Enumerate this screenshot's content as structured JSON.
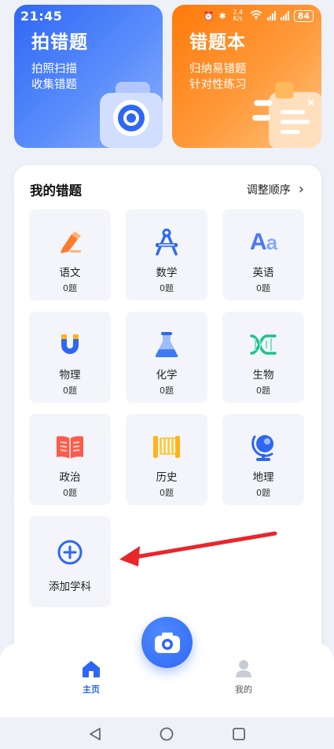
{
  "status_bar": {
    "time": "21:45",
    "net_speed": "2.4 K/s",
    "battery": "84"
  },
  "cards": {
    "capture": {
      "title": "拍错题",
      "subtitle_line1": "拍照扫描",
      "subtitle_line2": "收集错题"
    },
    "notebook": {
      "title": "错题本",
      "subtitle_line1": "归纳易错题",
      "subtitle_line2": "针对性练习"
    }
  },
  "panel": {
    "title": "我的错题",
    "reorder_label": "调整顺序"
  },
  "subjects": [
    {
      "name": "语文",
      "count": "0题",
      "icon": "pen-icon",
      "color": "#ff7a2e"
    },
    {
      "name": "数学",
      "count": "0题",
      "icon": "compass-icon",
      "color": "#2f67f4"
    },
    {
      "name": "英语",
      "count": "0题",
      "icon": "aa-letters-icon",
      "color": "#4a78f5"
    },
    {
      "name": "物理",
      "count": "0题",
      "icon": "magnet-icon",
      "color": "#2f67f4"
    },
    {
      "name": "化学",
      "count": "0题",
      "icon": "flask-icon",
      "color": "#3b7cf6"
    },
    {
      "name": "生物",
      "count": "0题",
      "icon": "dna-icon",
      "color": "#1fc28a"
    },
    {
      "name": "政治",
      "count": "0题",
      "icon": "book-icon",
      "color": "#ff5a4a"
    },
    {
      "name": "历史",
      "count": "0题",
      "icon": "scroll-icon",
      "color": "#ffb31a"
    },
    {
      "name": "地理",
      "count": "0题",
      "icon": "globe-icon",
      "color": "#2f67f4"
    }
  ],
  "add_subject": {
    "label": "添加学科",
    "icon": "plus-circle-icon"
  },
  "nav": {
    "home_label": "主页",
    "mine_label": "我的"
  },
  "colors": {
    "brand_blue": "#2f67f4",
    "brand_orange": "#ff8a1f",
    "annotation_red": "#e8262b"
  }
}
